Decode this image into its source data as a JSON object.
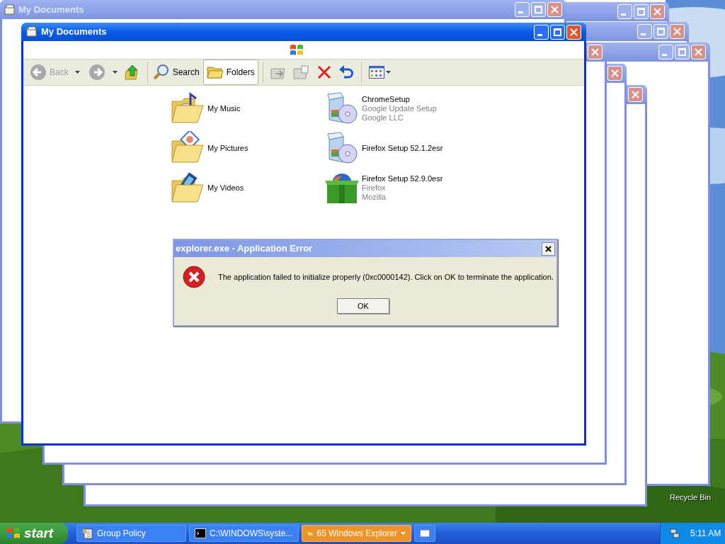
{
  "background_windows": [
    {
      "title": "My Documents"
    }
  ],
  "explorer": {
    "title": "My Documents",
    "toolbar": {
      "back": {
        "label": "Back",
        "disabled": true
      },
      "forward": {
        "disabled": true
      },
      "search": {
        "label": "Search"
      },
      "folders": {
        "label": "Folders",
        "selected": true
      },
      "move_to": {
        "disabled": true
      },
      "copy_to": {
        "disabled": true
      }
    },
    "items": [
      {
        "name": "My Music",
        "kind": "music"
      },
      {
        "name": "My Pictures",
        "kind": "pictures"
      },
      {
        "name": "My Videos",
        "kind": "videos"
      },
      {
        "name": "ChromeSetup",
        "kind": "installer",
        "details": [
          "Google Update Setup",
          "Google LLC"
        ]
      },
      {
        "name": "Firefox Setup 52.1.2esr",
        "kind": "installer"
      },
      {
        "name": "Firefox Setup 52.9.0esr",
        "kind": "firefox",
        "details": [
          "Firefox",
          "Mozilla"
        ]
      }
    ]
  },
  "dialog": {
    "title": "explorer.exe - Application Error",
    "message": "The application failed to initialize properly (0xc0000142). Click on OK to terminate the application.",
    "button": "OK"
  },
  "desktop_icons": [
    {
      "label": "Recycle Bin"
    }
  ],
  "taskbar": {
    "start": "start",
    "tasks": [
      {
        "kind": "policy",
        "label": "Group Policy",
        "flashing": false
      },
      {
        "kind": "console",
        "label": "C:\\WINDOWS\\syste...",
        "flashing": false
      },
      {
        "kind": "folder",
        "label": "65 Windows Explorer",
        "flashing": true,
        "group": true
      },
      {
        "kind": "blank",
        "flashing": false
      }
    ],
    "clock": "5:11 AM"
  }
}
